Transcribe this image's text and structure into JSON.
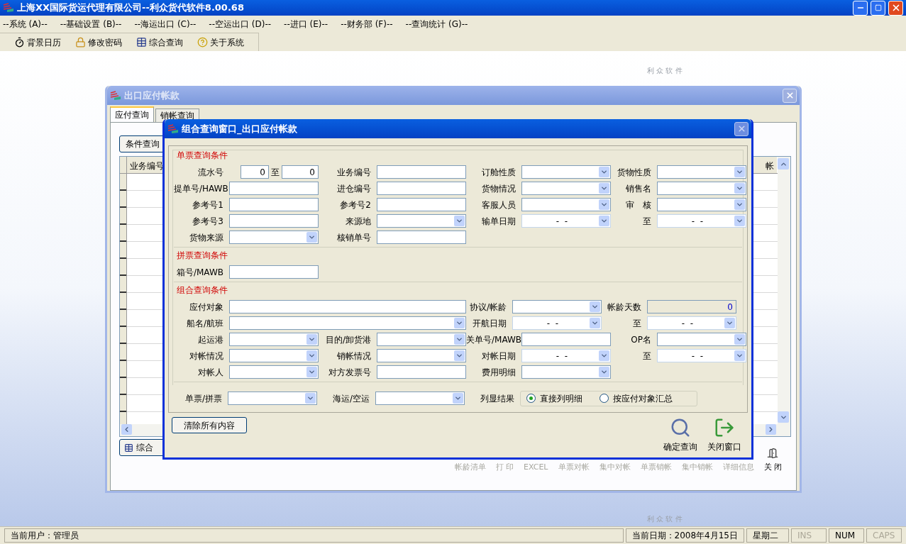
{
  "window": {
    "title": "上海XX国际货运代理有限公司--利众货代软件8.00.68"
  },
  "menu": [
    "--系统 (A)--",
    "--基础设置 (B)--",
    "--海运出口 (C)--",
    "--空运出口 (D)--",
    "--进口 (E)--",
    "--财务部 (F)--",
    "--查询统计 (G)--"
  ],
  "toolbar": [
    {
      "kind": "stopwatch",
      "label": "背景日历"
    },
    {
      "kind": "lock",
      "label": "修改密码"
    },
    {
      "kind": "table",
      "label": "综合查询"
    },
    {
      "kind": "help",
      "label": "关于系统"
    }
  ],
  "desktop": {
    "brand_captions": [
      "利 众 软 件",
      "利 众 软 件"
    ]
  },
  "payables_window": {
    "title": "出口应付帐款",
    "tabs": [
      {
        "label": "应付查询",
        "selected": true
      },
      {
        "label": "销帐查询",
        "selected": false
      }
    ],
    "query_button": "条件查询",
    "table": {
      "columns": [
        "业务编号",
        "帐"
      ]
    },
    "combined_button": "综合",
    "actions": [
      {
        "label": "帐龄清单",
        "disabled": true
      },
      {
        "label": "打 印",
        "disabled": true
      },
      {
        "label": "EXCEL",
        "disabled": true
      },
      {
        "label": "单票对帐",
        "disabled": true
      },
      {
        "label": "集中对帐",
        "disabled": true
      },
      {
        "label": "单票销帐",
        "disabled": true
      },
      {
        "label": "集中销帐",
        "disabled": true
      },
      {
        "label": "详细信息",
        "disabled": true
      },
      {
        "label": "关 闭",
        "disabled": false
      }
    ]
  },
  "dialog": {
    "title": "组合查询窗口_出口应付帐款",
    "sections": [
      {
        "title": "单票查询条件",
        "rows": [
          [
            {
              "label": "流水号",
              "kind": "range",
              "from": "0",
              "separator": "至",
              "to": "0"
            },
            {
              "label": "业务编号",
              "kind": "text"
            },
            {
              "label": "订舱性质",
              "kind": "combo"
            },
            {
              "label": "货物性质",
              "kind": "combo"
            }
          ],
          [
            {
              "label": "提单号/HAWB",
              "kind": "text"
            },
            {
              "label": "进仓编号",
              "kind": "text"
            },
            {
              "label": "货物情况",
              "kind": "combo"
            },
            {
              "label": "销售名",
              "kind": "combo"
            }
          ],
          [
            {
              "label": "参考号1",
              "kind": "text"
            },
            {
              "label": "参考号2",
              "kind": "text"
            },
            {
              "label": "客服人员",
              "kind": "combo"
            },
            {
              "label": "审　核",
              "kind": "combo"
            }
          ],
          [
            {
              "label": "参考号3",
              "kind": "text"
            },
            {
              "label": "来源地",
              "kind": "combo"
            },
            {
              "label": "输单日期",
              "kind": "date",
              "value": "-  -"
            },
            {
              "label": "至",
              "kind": "date",
              "value": "-  -"
            }
          ],
          [
            {
              "label": "货物来源",
              "kind": "combo"
            },
            {
              "label": "核销单号",
              "kind": "text"
            }
          ]
        ]
      },
      {
        "title": "拼票查询条件",
        "rows": [
          [
            {
              "label": "箱号/MAWB",
              "kind": "text"
            }
          ]
        ]
      },
      {
        "title": "组合查询条件",
        "rows": [
          [
            {
              "label": "应付对象",
              "kind": "long_text"
            },
            {
              "label": "协议/帐龄",
              "kind": "combo"
            },
            {
              "label": "帐龄天数",
              "kind": "number",
              "value": "0"
            }
          ],
          [
            {
              "label": "船名/航班",
              "kind": "long_combo"
            },
            {
              "label": "开航日期",
              "kind": "date",
              "value": "-  -"
            },
            {
              "label": "至",
              "kind": "date",
              "value": "-  -"
            }
          ],
          [
            {
              "label": "起运港",
              "kind": "combo"
            },
            {
              "label": "目的/卸货港",
              "kind": "combo"
            },
            {
              "label": "关单号/MAWB",
              "kind": "text"
            },
            {
              "label": "OP名",
              "kind": "combo"
            }
          ],
          [
            {
              "label": "对帐情况",
              "kind": "combo"
            },
            {
              "label": "销帐情况",
              "kind": "combo"
            },
            {
              "label": "对帐日期",
              "kind": "date",
              "value": "-  -"
            },
            {
              "label": "至",
              "kind": "date",
              "value": "-  -"
            }
          ],
          [
            {
              "label": "对帐人",
              "kind": "combo"
            },
            {
              "label": "对方发票号",
              "kind": "text"
            },
            {
              "label": "费用明细",
              "kind": "combo"
            }
          ]
        ]
      }
    ],
    "bottom_row": [
      {
        "label": "单票/拼票",
        "kind": "combo"
      },
      {
        "label": "海运/空运",
        "kind": "combo"
      }
    ],
    "result_display": {
      "label": "列显结果",
      "options": [
        {
          "label": "直接列明细",
          "selected": true
        },
        {
          "label": "按应付对象汇总",
          "selected": false
        }
      ]
    },
    "clear_button": "清除所有内容",
    "buttons": [
      {
        "kind": "search",
        "label": "确定查询"
      },
      {
        "kind": "exit",
        "label": "关闭窗口"
      }
    ]
  },
  "status_bar": {
    "user": "当前用户：管理员",
    "date": "当前日期：2008年4月15日",
    "weekday": "星期二",
    "indicators": [
      {
        "label": "INS",
        "on": false
      },
      {
        "label": "NUM",
        "on": true
      },
      {
        "label": "CAPS",
        "on": false
      }
    ]
  }
}
